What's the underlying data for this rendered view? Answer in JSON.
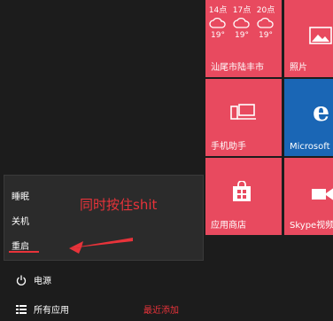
{
  "weather": {
    "times": [
      "14点",
      "17点",
      "20点"
    ],
    "temps": [
      "19°",
      "19°",
      "19°"
    ],
    "location": "汕尾市陆丰市"
  },
  "tiles": {
    "photos": "照片",
    "phone": "手机助手",
    "edge": "Microsoft",
    "store": "应用商店",
    "skype": "Skype视频"
  },
  "power_menu": {
    "items": [
      "睡眠",
      "关机",
      "重启"
    ]
  },
  "annotation": "同时按住shit",
  "bottom": {
    "power": "电源",
    "all_apps": "所有应用",
    "recently_added": "最近添加"
  }
}
